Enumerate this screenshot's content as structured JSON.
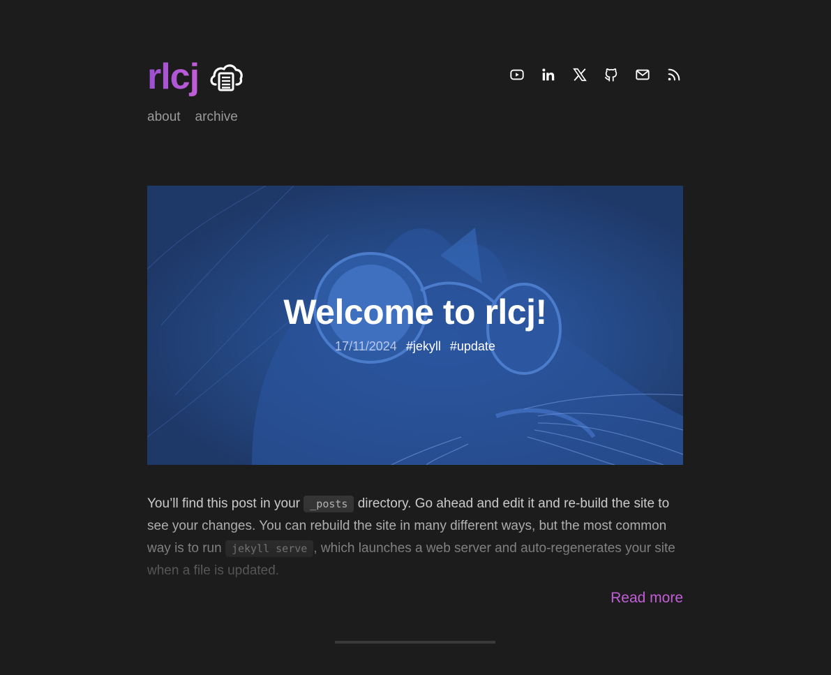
{
  "site": {
    "title": "rlcj",
    "accent_color": "#c25ed8",
    "background_color": "#1c1c1c",
    "logo_icon": "printer-cloud-icon"
  },
  "nav": {
    "items": [
      {
        "label": "about"
      },
      {
        "label": "archive"
      }
    ]
  },
  "social": {
    "icons": [
      "youtube-icon",
      "linkedin-icon",
      "x-icon",
      "github-icon",
      "mail-icon",
      "rss-icon"
    ]
  },
  "post": {
    "title": "Welcome to rlcj!",
    "date": "17/11/2024",
    "tags": [
      "#jekyll",
      "#update"
    ],
    "hero_tint_color": "#1f3a68",
    "excerpt": {
      "part1": "You’ll find this post in your ",
      "code1": "_posts",
      "part2": " directory. Go ahead and edit it and re-build the site to see your changes. You can rebuild the site in many different ways, but the most common way is to run ",
      "code2": "jekyll serve",
      "part3": ", which launches a web server and auto-regenerates your site when a file is updated."
    },
    "read_more_label": "Read more"
  }
}
